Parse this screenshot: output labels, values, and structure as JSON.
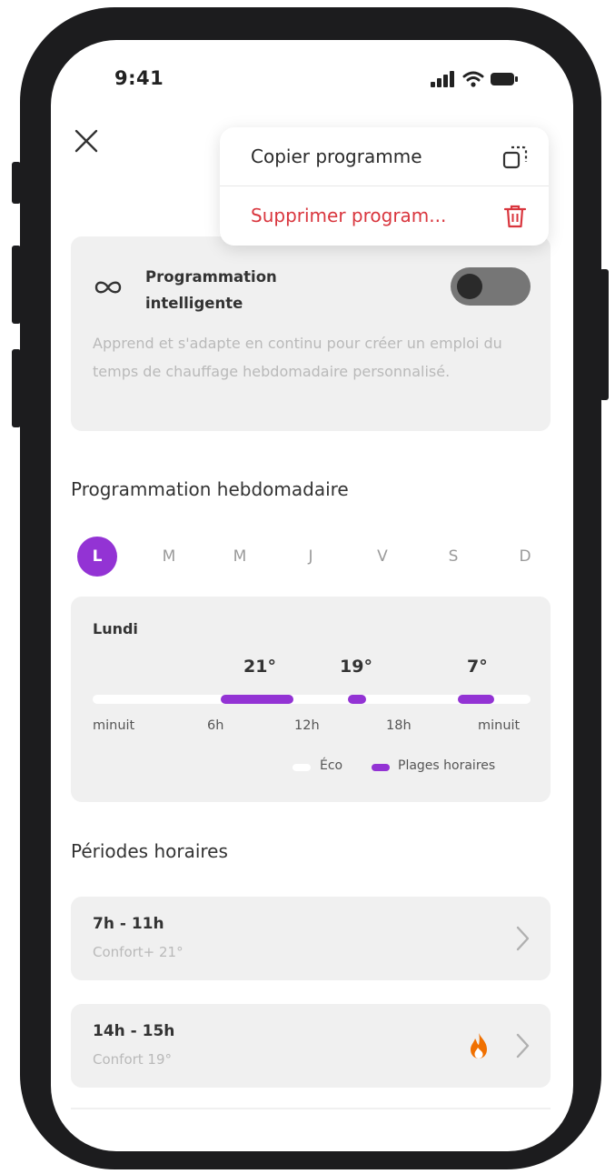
{
  "status_bar": {
    "time": "9:41",
    "icons": [
      "signal-icon",
      "wifi-icon",
      "battery-icon"
    ]
  },
  "header": {
    "close_icon": "close-icon"
  },
  "menu": {
    "copy_label": "Copier programme",
    "copy_icon": "copy-icon",
    "delete_label": "Supprimer program...",
    "delete_icon": "trash-icon",
    "delete_color": "#d9363e"
  },
  "smart": {
    "icon": "infinity-icon",
    "title_line1": "Programmation",
    "title_line2": "intelligente",
    "description": "Apprend et s'adapte en continu pour créer un emploi du temps de chauffage hebdomadaire personnalisé.",
    "toggle_on": false
  },
  "weekly": {
    "title": "Programmation hebdomadaire",
    "days": [
      "L",
      "M",
      "M",
      "J",
      "V",
      "S",
      "D"
    ],
    "selected_day_index": 0,
    "accent": "#9333d4"
  },
  "schedule": {
    "day_name": "Lundi",
    "temp_labels": [
      "21°",
      "19°",
      "7°"
    ],
    "time_ticks": [
      "minuit",
      "6h",
      "12h",
      "18h",
      "minuit"
    ],
    "slots_hours": [
      [
        7,
        11
      ],
      [
        14,
        15
      ],
      [
        20,
        22
      ]
    ],
    "legend_eco": "Éco",
    "legend_slots": "Plages horaires"
  },
  "periods": {
    "title": "Périodes horaires",
    "items": [
      {
        "range": "7h - 11h",
        "mode": "Confort+ 21°",
        "heating": false
      },
      {
        "range": "14h - 15h",
        "mode": "Confort 19°",
        "heating": true
      }
    ],
    "flame_color": "#f07000"
  }
}
